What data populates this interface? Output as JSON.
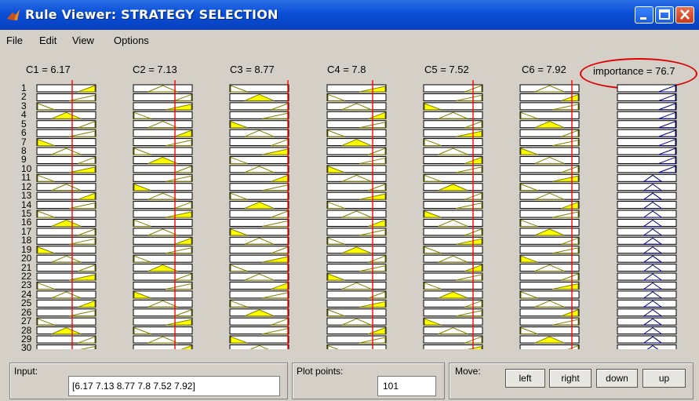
{
  "window": {
    "title": "Rule Viewer: STRATEGY SELECTION",
    "minimize_label": "_",
    "maximize_label": "□",
    "close_label": "X"
  },
  "menu": {
    "items": [
      "File",
      "Edit",
      "View",
      "Options"
    ]
  },
  "inputs": [
    {
      "label": "C1 = 6.17",
      "value": 6.17
    },
    {
      "label": "C2 = 7.13",
      "value": 7.13
    },
    {
      "label": "C3 = 8.77",
      "value": 8.77
    },
    {
      "label": "C4 = 7.8",
      "value": 7.8
    },
    {
      "label": "C5 = 7.52",
      "value": 7.52
    },
    {
      "label": "C6 = 7.92",
      "value": 7.92
    }
  ],
  "output": {
    "label": "importance = 76.7",
    "value": 76.7
  },
  "rules": [
    "1",
    "2",
    "3",
    "4",
    "5",
    "6",
    "7",
    "8",
    "9",
    "10",
    "11",
    "12",
    "13",
    "14",
    "15",
    "16",
    "17",
    "18",
    "19",
    "20",
    "21",
    "22",
    "23",
    "24",
    "25",
    "26",
    "27",
    "28",
    "29",
    "30"
  ],
  "colors": {
    "titlebar": "#0a4fd6",
    "fill": "#ffff00",
    "mf_line": "#808000",
    "input_line": "#ff0000",
    "output_line": "#000080",
    "highlight": "#e00000"
  },
  "controls": {
    "input_label": "Input:",
    "input_value": "[6.17 7.13 8.77 7.8 7.52 7.92]",
    "plot_points_label": "Plot points:",
    "plot_points_value": "101",
    "move_label": "Move:",
    "buttons": {
      "left": "left",
      "right": "right",
      "down": "down",
      "up": "up"
    }
  }
}
